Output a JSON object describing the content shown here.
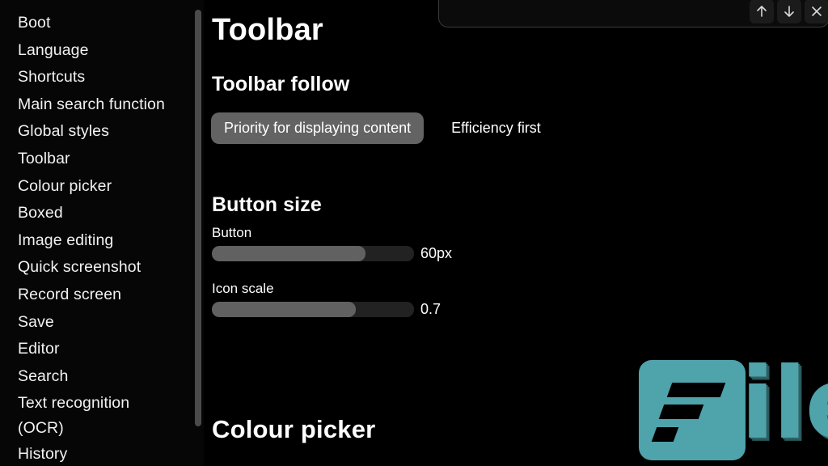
{
  "window": {
    "background_color": "#000000",
    "text_color": "#ffffff"
  },
  "sidebar": {
    "items": [
      {
        "label": "Boot"
      },
      {
        "label": "Language"
      },
      {
        "label": "Shortcuts"
      },
      {
        "label": "Main search function"
      },
      {
        "label": "Global styles"
      },
      {
        "label": "Toolbar"
      },
      {
        "label": "Colour picker"
      },
      {
        "label": "Boxed"
      },
      {
        "label": "Image editing"
      },
      {
        "label": "Quick screenshot"
      },
      {
        "label": "Record screen"
      },
      {
        "label": "Save"
      },
      {
        "label": "Editor"
      },
      {
        "label": "Search"
      },
      {
        "label": "Text recognition",
        "label_line2": "(OCR)"
      },
      {
        "label": "History"
      }
    ],
    "scrollbar_color": "#4a4a4a"
  },
  "find_panel": {
    "input_value": "",
    "buttons": [
      {
        "name": "find-previous",
        "icon": "arrow-up-icon"
      },
      {
        "name": "find-next",
        "icon": "arrow-down-icon"
      },
      {
        "name": "close-find",
        "icon": "close-icon"
      }
    ]
  },
  "main": {
    "page_title": "Toolbar",
    "sections": {
      "toolbar_follow": {
        "heading": "Toolbar follow",
        "options": [
          {
            "label": "Priority for displaying content",
            "selected": true
          },
          {
            "label": "Efficiency first",
            "selected": false
          }
        ],
        "selected_color": "#636363"
      },
      "button_size": {
        "heading": "Button size",
        "sliders": [
          {
            "label": "Button",
            "value_text": "60px",
            "fill_percent": 76,
            "track_color": "#222222",
            "fill_color": "#616161"
          },
          {
            "label": "Icon scale",
            "value_text": "0.7",
            "fill_percent": 71,
            "track_color": "#222222",
            "fill_color": "#616161"
          }
        ]
      },
      "colour_picker": {
        "heading": "Colour picker"
      }
    }
  },
  "watermark": {
    "mark_letter": "F",
    "text": "ileCR",
    "color": "#4fa3aa"
  }
}
